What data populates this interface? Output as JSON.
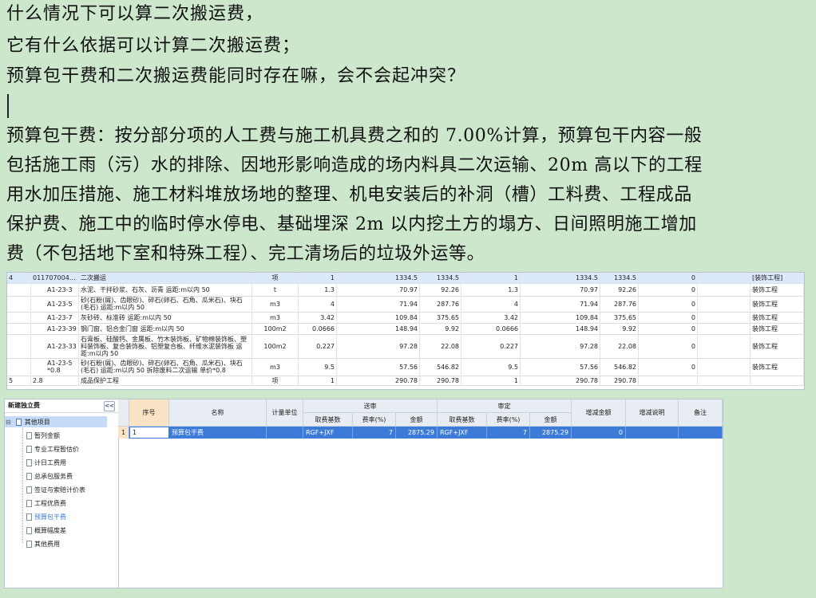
{
  "question": {
    "line1": "什么情况下可以算二次搬运费，",
    "line2": "它有什么依据可以计算二次搬运费；",
    "line3": "预算包干费和二次搬运费能同时存在嘛，会不会起冲突？"
  },
  "answer": {
    "lines": [
      "预算包干费：按分部分项的人工费与施工机具费之和的 7.00%计算，预算包干内容一般",
      "包括施工雨（污）水的排除、因地形影响造成的场内料具二次运输、20m 高以下的工程",
      "用水加压措施、施工材料堆放场地的整理、机电安装后的补洞（槽）工料费、工程成品",
      "保护费、施工中的临时停水停电、基础埋深 2m 以内挖土方的塌方、日间照明施工增加",
      "费（不包括地下室和特殊工程）、完工清场后的垃圾外运等。"
    ]
  },
  "grid1": {
    "rows": [
      {
        "num": "4",
        "code": "011707004…",
        "name": "二次搬运",
        "unit": "项",
        "q1": "1",
        "p1": "1334.5",
        "t1": "1334.5",
        "q2": "1",
        "p2": "1334.5",
        "t2": "1334.5",
        "d": "0",
        "spec": "[装饰工程]"
      },
      {
        "num": "",
        "code": "A1-23-3",
        "name": "水泥、干拌砂浆、石灰、沥青 运距:m以内 50",
        "unit": "t",
        "q1": "1.3",
        "p1": "70.97",
        "t1": "92.26",
        "q2": "1.3",
        "p2": "70.97",
        "t2": "92.26",
        "d": "0",
        "spec": "装饰工程"
      },
      {
        "num": "",
        "code": "A1-23-5",
        "name": "砂(石粉(屑)、齿眼砂)、碎石(卵石、石角、瓜米石)、块石(毛石) 运距:m以内 50",
        "unit": "m3",
        "q1": "4",
        "p1": "71.94",
        "t1": "287.76",
        "q2": "4",
        "p2": "71.94",
        "t2": "287.76",
        "d": "0",
        "spec": "装饰工程"
      },
      {
        "num": "",
        "code": "A1-23-7",
        "name": "灰砂砖、标准砖 运距:m以内 50",
        "unit": "m3",
        "q1": "3.42",
        "p1": "109.84",
        "t1": "375.65",
        "q2": "3.42",
        "p2": "109.84",
        "t2": "375.65",
        "d": "0",
        "spec": "装饰工程"
      },
      {
        "num": "",
        "code": "A1-23-39",
        "name": "钢门窗、铝合金门窗 运距:m以内 50",
        "unit": "100m2",
        "q1": "0.0666",
        "p1": "148.94",
        "t1": "9.92",
        "q2": "0.0666",
        "p2": "148.94",
        "t2": "9.92",
        "d": "0",
        "spec": "装饰工程"
      },
      {
        "num": "",
        "code": "A1-23-33",
        "name": "石膏板、硅酸钙、金属板、竹木装饰板、矿物棉装饰板、塑料装饰板、复合装饰板、铝塑复合板、纤维水泥装饰板 运距:m以内 50",
        "unit": "100m2",
        "q1": "0.227",
        "p1": "97.28",
        "t1": "22.08",
        "q2": "0.227",
        "p2": "97.28",
        "t2": "22.08",
        "d": "0",
        "spec": "装饰工程"
      },
      {
        "num": "",
        "code": "A1-23-5 *0.8",
        "name": "砂(石粉(屑)、齿眼砂)、碎石(卵石、石角、瓜米石)、块石(毛石) 运距:m以内 50 拆除废料二次运输 单价*0.8",
        "unit": "m3",
        "q1": "9.5",
        "p1": "57.56",
        "t1": "546.82",
        "q2": "9.5",
        "p2": "57.56",
        "t2": "546.82",
        "d": "0",
        "spec": "装饰工程"
      },
      {
        "num": "5",
        "code": "2.8",
        "name": "成品保护工程",
        "unit": "项",
        "q1": "1",
        "p1": "290.78",
        "t1": "290.78",
        "q2": "1",
        "p2": "290.78",
        "t2": "290.78",
        "d": "",
        "spec": ""
      }
    ]
  },
  "tree": {
    "title": "新建独立费",
    "collapse": "<<",
    "root": "其他项目",
    "items": [
      "暂列金额",
      "专业工程暂估价",
      "计日工费用",
      "总承包服务费",
      "签证与索赔计价表",
      "工程优质费",
      "预算包干费",
      "概算幅度差",
      "其他费用"
    ],
    "selected_index": 6,
    "colors": {
      "selected_text": "#3b78d8",
      "root_bg": "#c5dbf7"
    }
  },
  "table": {
    "headers": {
      "seq": "序号",
      "name": "名称",
      "unit": "计量单位",
      "submit": "送审",
      "review": "审定",
      "base": "取费基数",
      "rate": "费率(%)",
      "amount": "金额",
      "diff": "增减金额",
      "diff_note": "增减说明",
      "remark": "备注"
    },
    "row": {
      "row_no": "1",
      "seq": "1",
      "name": "预算包干费",
      "unit": "",
      "s_base": "RGF+JXF",
      "s_rate": "7",
      "s_amount": "2875.29",
      "r_base": "RGF+JXF",
      "r_rate": "7",
      "r_amount": "2875.29",
      "diff": "0",
      "diff_note": "",
      "remark": ""
    },
    "colors": {
      "selection": "#3d7bd9",
      "header": "#e8edf3",
      "seq_header": "#fbe3c5"
    }
  }
}
